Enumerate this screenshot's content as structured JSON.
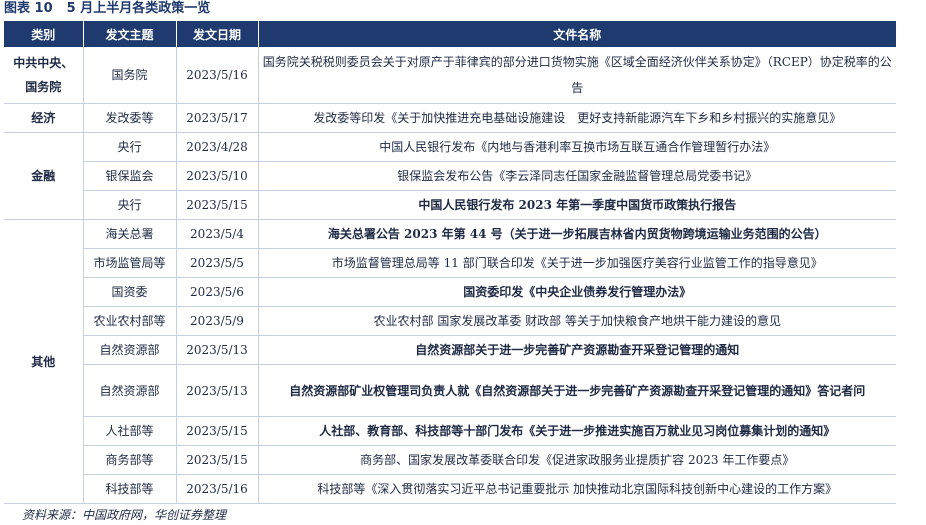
{
  "title": {
    "label": "图表 10",
    "text": "5 月上半月各类政策一览"
  },
  "headers": [
    "类别",
    "发文主题",
    "发文日期",
    "文件名称"
  ],
  "rows": [
    {
      "category": "中共中央、国务院",
      "cat_rowspan": 1,
      "issuer": "国务院",
      "date": "2023/5/16",
      "title": "国务院关税税则委员会关于对原产于菲律宾的部分进口货物实施《区域全面经济伙伴关系协定》（RCEP）协定税率的公告",
      "bold": false,
      "wrap": true
    },
    {
      "category": "经济",
      "cat_rowspan": 1,
      "issuer": "发改委等",
      "date": "2023/5/17",
      "title": "发改委等印发《关于加快推进充电基础设施建设　更好支持新能源汽车下乡和乡村振兴的实施意见》",
      "bold": false,
      "wrap": false
    },
    {
      "category": "金融",
      "cat_rowspan": 3,
      "issuer": "央行",
      "date": "2023/4/28",
      "title": "中国人民银行发布《内地与香港利率互换市场互联互通合作管理暂行办法》",
      "bold": false,
      "wrap": false
    },
    {
      "category": null,
      "issuer": "银保监会",
      "date": "2023/5/10",
      "title": "银保监会发布公告《李云泽同志任国家金融监督管理总局党委书记》",
      "bold": false,
      "wrap": false
    },
    {
      "category": null,
      "issuer": "央行",
      "date": "2023/5/15",
      "title": "中国人民银行发布 2023 年第一季度中国货币政策执行报告",
      "bold": true,
      "wrap": false
    },
    {
      "category": "其他",
      "cat_rowspan": 9,
      "issuer": "海关总署",
      "date": "2023/5/4",
      "title": "海关总署公告 2023 年第 44 号（关于进一步拓展吉林省内贸货物跨境运输业务范围的公告）",
      "bold": true,
      "wrap": false
    },
    {
      "category": null,
      "issuer": "市场监管局等",
      "date": "2023/5/5",
      "title": "市场监督管理总局等 11 部门联合印发《关于进一步加强医疗美容行业监管工作的指导意见》",
      "bold": false,
      "wrap": false
    },
    {
      "category": null,
      "issuer": "国资委",
      "date": "2023/5/6",
      "title": "国资委印发《中央企业债券发行管理办法》",
      "bold": true,
      "wrap": false
    },
    {
      "category": null,
      "issuer": "农业农村部等",
      "date": "2023/5/9",
      "title": "农业农村部 国家发展改革委 财政部 等关于加快粮食产地烘干能力建设的意见",
      "bold": false,
      "wrap": false
    },
    {
      "category": null,
      "issuer": "自然资源部",
      "date": "2023/5/13",
      "title": "自然资源部关于进一步完善矿产资源勘查开采登记管理的通知",
      "bold": true,
      "wrap": false
    },
    {
      "category": null,
      "issuer": "自然资源部",
      "date": "2023/5/13",
      "title": "自然资源部矿业权管理司负责人就《自然资源部关于进一步完善矿产资源勘查开采登记管理的通知》答记者问",
      "bold": true,
      "wrap": true
    },
    {
      "category": null,
      "issuer": "人社部等",
      "date": "2023/5/15",
      "title": "人社部、教育部、科技部等十部门发布《关于进一步推进实施百万就业见习岗位募集计划的通知》",
      "bold": true,
      "wrap": false
    },
    {
      "category": null,
      "issuer": "商务部等",
      "date": "2023/5/15",
      "title": "商务部、国家发展改革委联合印发《促进家政服务业提质扩容 2023 年工作要点》",
      "bold": false,
      "wrap": false
    },
    {
      "category": null,
      "issuer": "科技部等",
      "date": "2023/5/16",
      "title": "科技部等《深入贯彻落实习近平总书记重要批示 加快推动北京国际科技创新中心建设的工作方案》",
      "bold": false,
      "wrap": false
    }
  ],
  "source": "资料来源：中国政府网，华创证券整理"
}
